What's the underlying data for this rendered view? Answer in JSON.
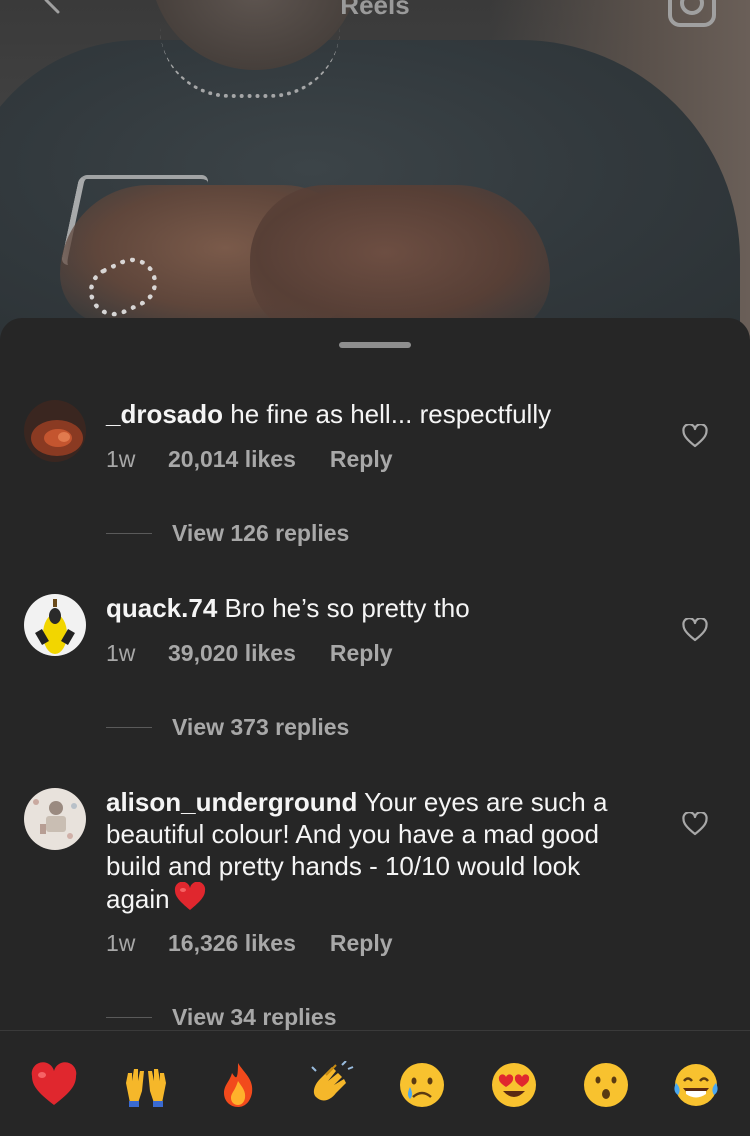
{
  "header": {
    "title": "Reels"
  },
  "comments": [
    {
      "username": "_drosado",
      "text": " he fine as hell... respectfully",
      "time": "1w",
      "likes": "20,014 likes",
      "reply": "Reply",
      "view_replies": "View 126 replies"
    },
    {
      "username": "quack.74",
      "text": " Bro he’s so pretty tho",
      "time": "1w",
      "likes": "39,020 likes",
      "reply": "Reply",
      "view_replies": "View 373 replies"
    },
    {
      "username": "alison_underground",
      "text": " Your eyes are such a beautiful colour! And you have a mad good build and pretty hands - 10/10 would look again",
      "time": "1w",
      "likes": "16,326 likes",
      "reply": "Reply",
      "view_replies": "View 34 replies"
    }
  ],
  "quick_reactions": [
    {
      "icon": "red-heart-icon"
    },
    {
      "icon": "raised-hands-icon"
    },
    {
      "icon": "fire-icon"
    },
    {
      "icon": "clapping-hands-icon"
    },
    {
      "icon": "crying-face-icon"
    },
    {
      "icon": "heart-eyes-face-icon"
    },
    {
      "icon": "surprised-face-icon"
    },
    {
      "icon": "tears-of-joy-face-icon"
    }
  ],
  "colors": {
    "sheet_background": "#262626",
    "primary_text": "#f5f5f5",
    "secondary_text": "#a8a8a8"
  }
}
